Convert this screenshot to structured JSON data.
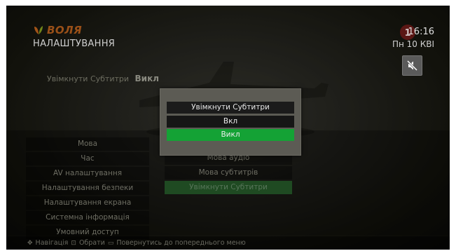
{
  "brand": {
    "name": "ВОЛЯ"
  },
  "header": {
    "title": "НАЛАШТУВАННЯ",
    "time": "16:16",
    "date": "Пн 10 КВІ"
  },
  "status": {
    "label": "Увімкнути Субтитри",
    "value": "Викл"
  },
  "left_menu": {
    "items": [
      {
        "label": "Мова"
      },
      {
        "label": "Час"
      },
      {
        "label": "AV налаштування"
      },
      {
        "label": "Налаштування безпеки"
      },
      {
        "label": "Налаштування екрана"
      },
      {
        "label": "Системна інформація"
      },
      {
        "label": "Умовний доступ"
      }
    ]
  },
  "right_menu": {
    "items": [
      {
        "label": "Мова аудіо"
      },
      {
        "label": "Мова субтитрів"
      },
      {
        "label": "Увімкнути Субтитри",
        "active": true
      }
    ]
  },
  "dialog": {
    "title": "Увімкнути Субтитри",
    "options": [
      {
        "label": "Вкл",
        "selected": false
      },
      {
        "label": "Викл",
        "selected": true
      }
    ],
    "selected_color": "#14a235"
  },
  "footer": {
    "nav_label": "Навігація",
    "select_label": "Обрати",
    "back_label": "Повернутись до попереднього меню"
  },
  "icons": {
    "mute": "speaker-muted-icon",
    "channel": "channel-logo-icon",
    "brand": "voля-leaf-logo-icon"
  }
}
